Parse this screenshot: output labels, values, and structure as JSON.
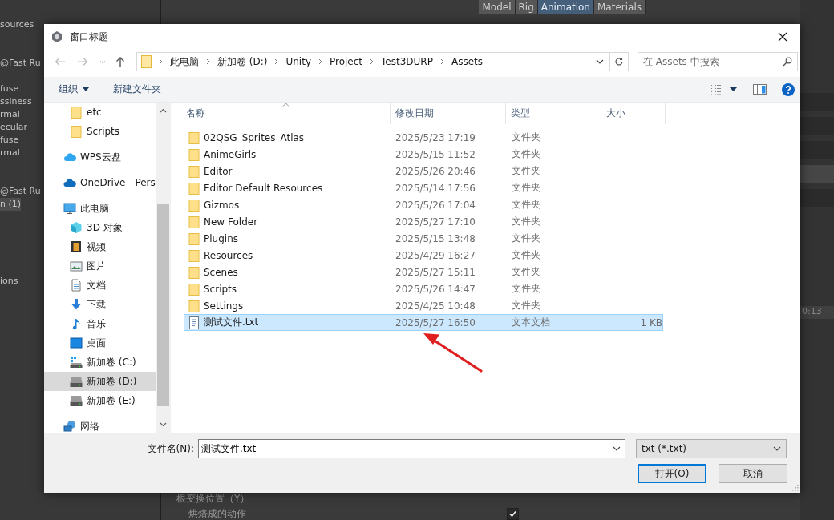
{
  "background": {
    "left_panel": [
      {
        "label": "sources",
        "selected": false
      },
      {
        "label": "@Fast Ru",
        "selected": false
      },
      {
        "label": "fuse",
        "selected": false
      },
      {
        "label": "ssiness",
        "selected": false
      },
      {
        "label": "rmal",
        "selected": false
      },
      {
        "label": "ecular",
        "selected": false
      },
      {
        "label": "fuse",
        "selected": false
      },
      {
        "label": "rmal",
        "selected": false
      },
      {
        "label": "@Fast Ru",
        "selected": false
      },
      {
        "label": "n (1)",
        "selected": true
      },
      {
        "label": "ions",
        "selected": false
      }
    ],
    "inspector_tabs": [
      {
        "label": "Model",
        "selected": false
      },
      {
        "label": "Rig",
        "selected": false
      },
      {
        "label": "Animation",
        "selected": true
      },
      {
        "label": "Materials",
        "selected": false
      }
    ],
    "timeline_time": "0:13",
    "root_position_label": "根变换位置（Y）",
    "baked_motion": {
      "label": "烘焙成的动作",
      "checked": true
    }
  },
  "dialog": {
    "title": "窗口标题",
    "breadcrumbs": [
      "此电脑",
      "新加卷 (D:)",
      "Unity",
      "Project",
      "Test3DURP",
      "Assets"
    ],
    "search": {
      "placeholder": "在 Assets 中搜索"
    },
    "commands": [
      {
        "label": "组织",
        "kind": "menu"
      },
      {
        "label": "新建文件夹",
        "kind": "button"
      }
    ],
    "nav_pane": {
      "quick_access_children": [
        {
          "label": "etc",
          "kind": "folder",
          "selected": false
        },
        {
          "label": "Scripts",
          "kind": "folder",
          "selected": false
        }
      ],
      "items": [
        {
          "label": "WPS云盘",
          "kind": "wps",
          "selected": false
        },
        {
          "label": "OneDrive - Pers",
          "kind": "onedrive",
          "selected": false
        },
        {
          "label": "此电脑",
          "kind": "pc",
          "selected": false,
          "children": [
            {
              "label": "3D 对象",
              "kind": "cube",
              "selected": false
            },
            {
              "label": "视频",
              "kind": "video",
              "selected": false
            },
            {
              "label": "图片",
              "kind": "picture",
              "selected": false
            },
            {
              "label": "文档",
              "kind": "doc",
              "selected": false
            },
            {
              "label": "下载",
              "kind": "download",
              "selected": false
            },
            {
              "label": "音乐",
              "kind": "music",
              "selected": false
            },
            {
              "label": "桌面",
              "kind": "desktop",
              "selected": false
            },
            {
              "label": "新加卷 (C:)",
              "kind": "drive-win",
              "selected": false
            },
            {
              "label": "新加卷 (D:)",
              "kind": "drive",
              "selected": true
            },
            {
              "label": "新加卷 (E:)",
              "kind": "drive",
              "selected": false
            }
          ]
        },
        {
          "label": "网络",
          "kind": "network",
          "selected": false
        }
      ]
    },
    "columns": [
      "名称",
      "修改日期",
      "类型",
      "大小"
    ],
    "files": [
      {
        "name": "02QSG_Sprites_Atlas",
        "date": "2025/5/23 17:19",
        "type": "文件夹",
        "kind": "folder",
        "selected": false
      },
      {
        "name": "AnimeGirls",
        "date": "2025/5/15 11:52",
        "type": "文件夹",
        "kind": "folder",
        "selected": false
      },
      {
        "name": "Editor",
        "date": "2025/5/26 20:46",
        "type": "文件夹",
        "kind": "folder",
        "selected": false
      },
      {
        "name": "Editor Default Resources",
        "date": "2025/5/14 17:56",
        "type": "文件夹",
        "kind": "folder",
        "selected": false
      },
      {
        "name": "Gizmos",
        "date": "2025/5/26 17:04",
        "type": "文件夹",
        "kind": "folder",
        "selected": false
      },
      {
        "name": "New Folder",
        "date": "2025/5/27 17:10",
        "type": "文件夹",
        "kind": "folder",
        "selected": false
      },
      {
        "name": "Plugins",
        "date": "2025/5/15 13:48",
        "type": "文件夹",
        "kind": "folder",
        "selected": false
      },
      {
        "name": "Resources",
        "date": "2025/4/29 16:27",
        "type": "文件夹",
        "kind": "folder",
        "selected": false
      },
      {
        "name": "Scenes",
        "date": "2025/5/27 15:11",
        "type": "文件夹",
        "kind": "folder",
        "selected": false
      },
      {
        "name": "Scripts",
        "date": "2025/5/26 14:47",
        "type": "文件夹",
        "kind": "folder",
        "selected": false
      },
      {
        "name": "Settings",
        "date": "2025/4/25 10:48",
        "type": "文件夹",
        "kind": "folder",
        "selected": false
      },
      {
        "name": "测试文件.txt",
        "date": "2025/5/27 16:50",
        "type": "文本文档",
        "size": "1 KB",
        "kind": "text",
        "selected": true
      }
    ],
    "file_name": {
      "label": "文件名(N):",
      "value": "测试文件.txt"
    },
    "file_type": "txt (*.txt)",
    "buttons": [
      {
        "label": "打开(O)",
        "default": true
      },
      {
        "label": "取消",
        "default": false
      }
    ]
  }
}
